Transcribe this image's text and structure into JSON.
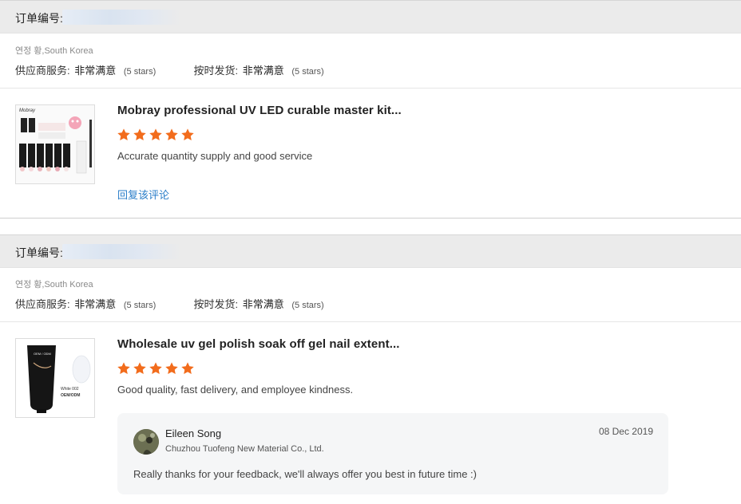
{
  "orders": [
    {
      "order_label": "订单编号:",
      "buyer": "연정 황,South Korea",
      "supplier_service_label": "供应商服务:",
      "supplier_service_value": "非常满意",
      "supplier_service_note": "(5 stars)",
      "on_time_label": "按时发货:",
      "on_time_value": "非常满意",
      "on_time_note": "(5 stars)",
      "product_title": "Mobray professional UV LED curable master kit...",
      "rating": 5,
      "review": "Accurate quantity supply and good service",
      "reply_link": "回复该评论"
    },
    {
      "order_label": "订单编号:",
      "buyer": "연정 황,South Korea",
      "supplier_service_label": "供应商服务:",
      "supplier_service_value": "非常满意",
      "supplier_service_note": "(5 stars)",
      "on_time_label": "按时发货:",
      "on_time_value": "非常满意",
      "on_time_note": "(5 stars)",
      "product_title": "Wholesale uv gel polish soak off gel nail extent...",
      "rating": 5,
      "review": "Good quality, fast delivery, and employee kindness.",
      "seller_reply": {
        "name": "Eileen Song",
        "company": "Chuzhou Tuofeng New Material Co., Ltd.",
        "date": "08 Dec 2019",
        "message": "Really thanks for your feedback, we'll always offer you best in future time :)"
      }
    }
  ],
  "thumbs": {
    "product1_brand": "Mobray",
    "product2_brand": "OEM / ODM",
    "product2_tube_text": "White 002",
    "product2_tube_sub": "OEM/ODM"
  },
  "colors": {
    "star": "#f26c1c",
    "link": "#2a7ec9",
    "header_bg": "#ebebeb"
  },
  "icons": {
    "star": "star-icon",
    "avatar": "avatar"
  }
}
